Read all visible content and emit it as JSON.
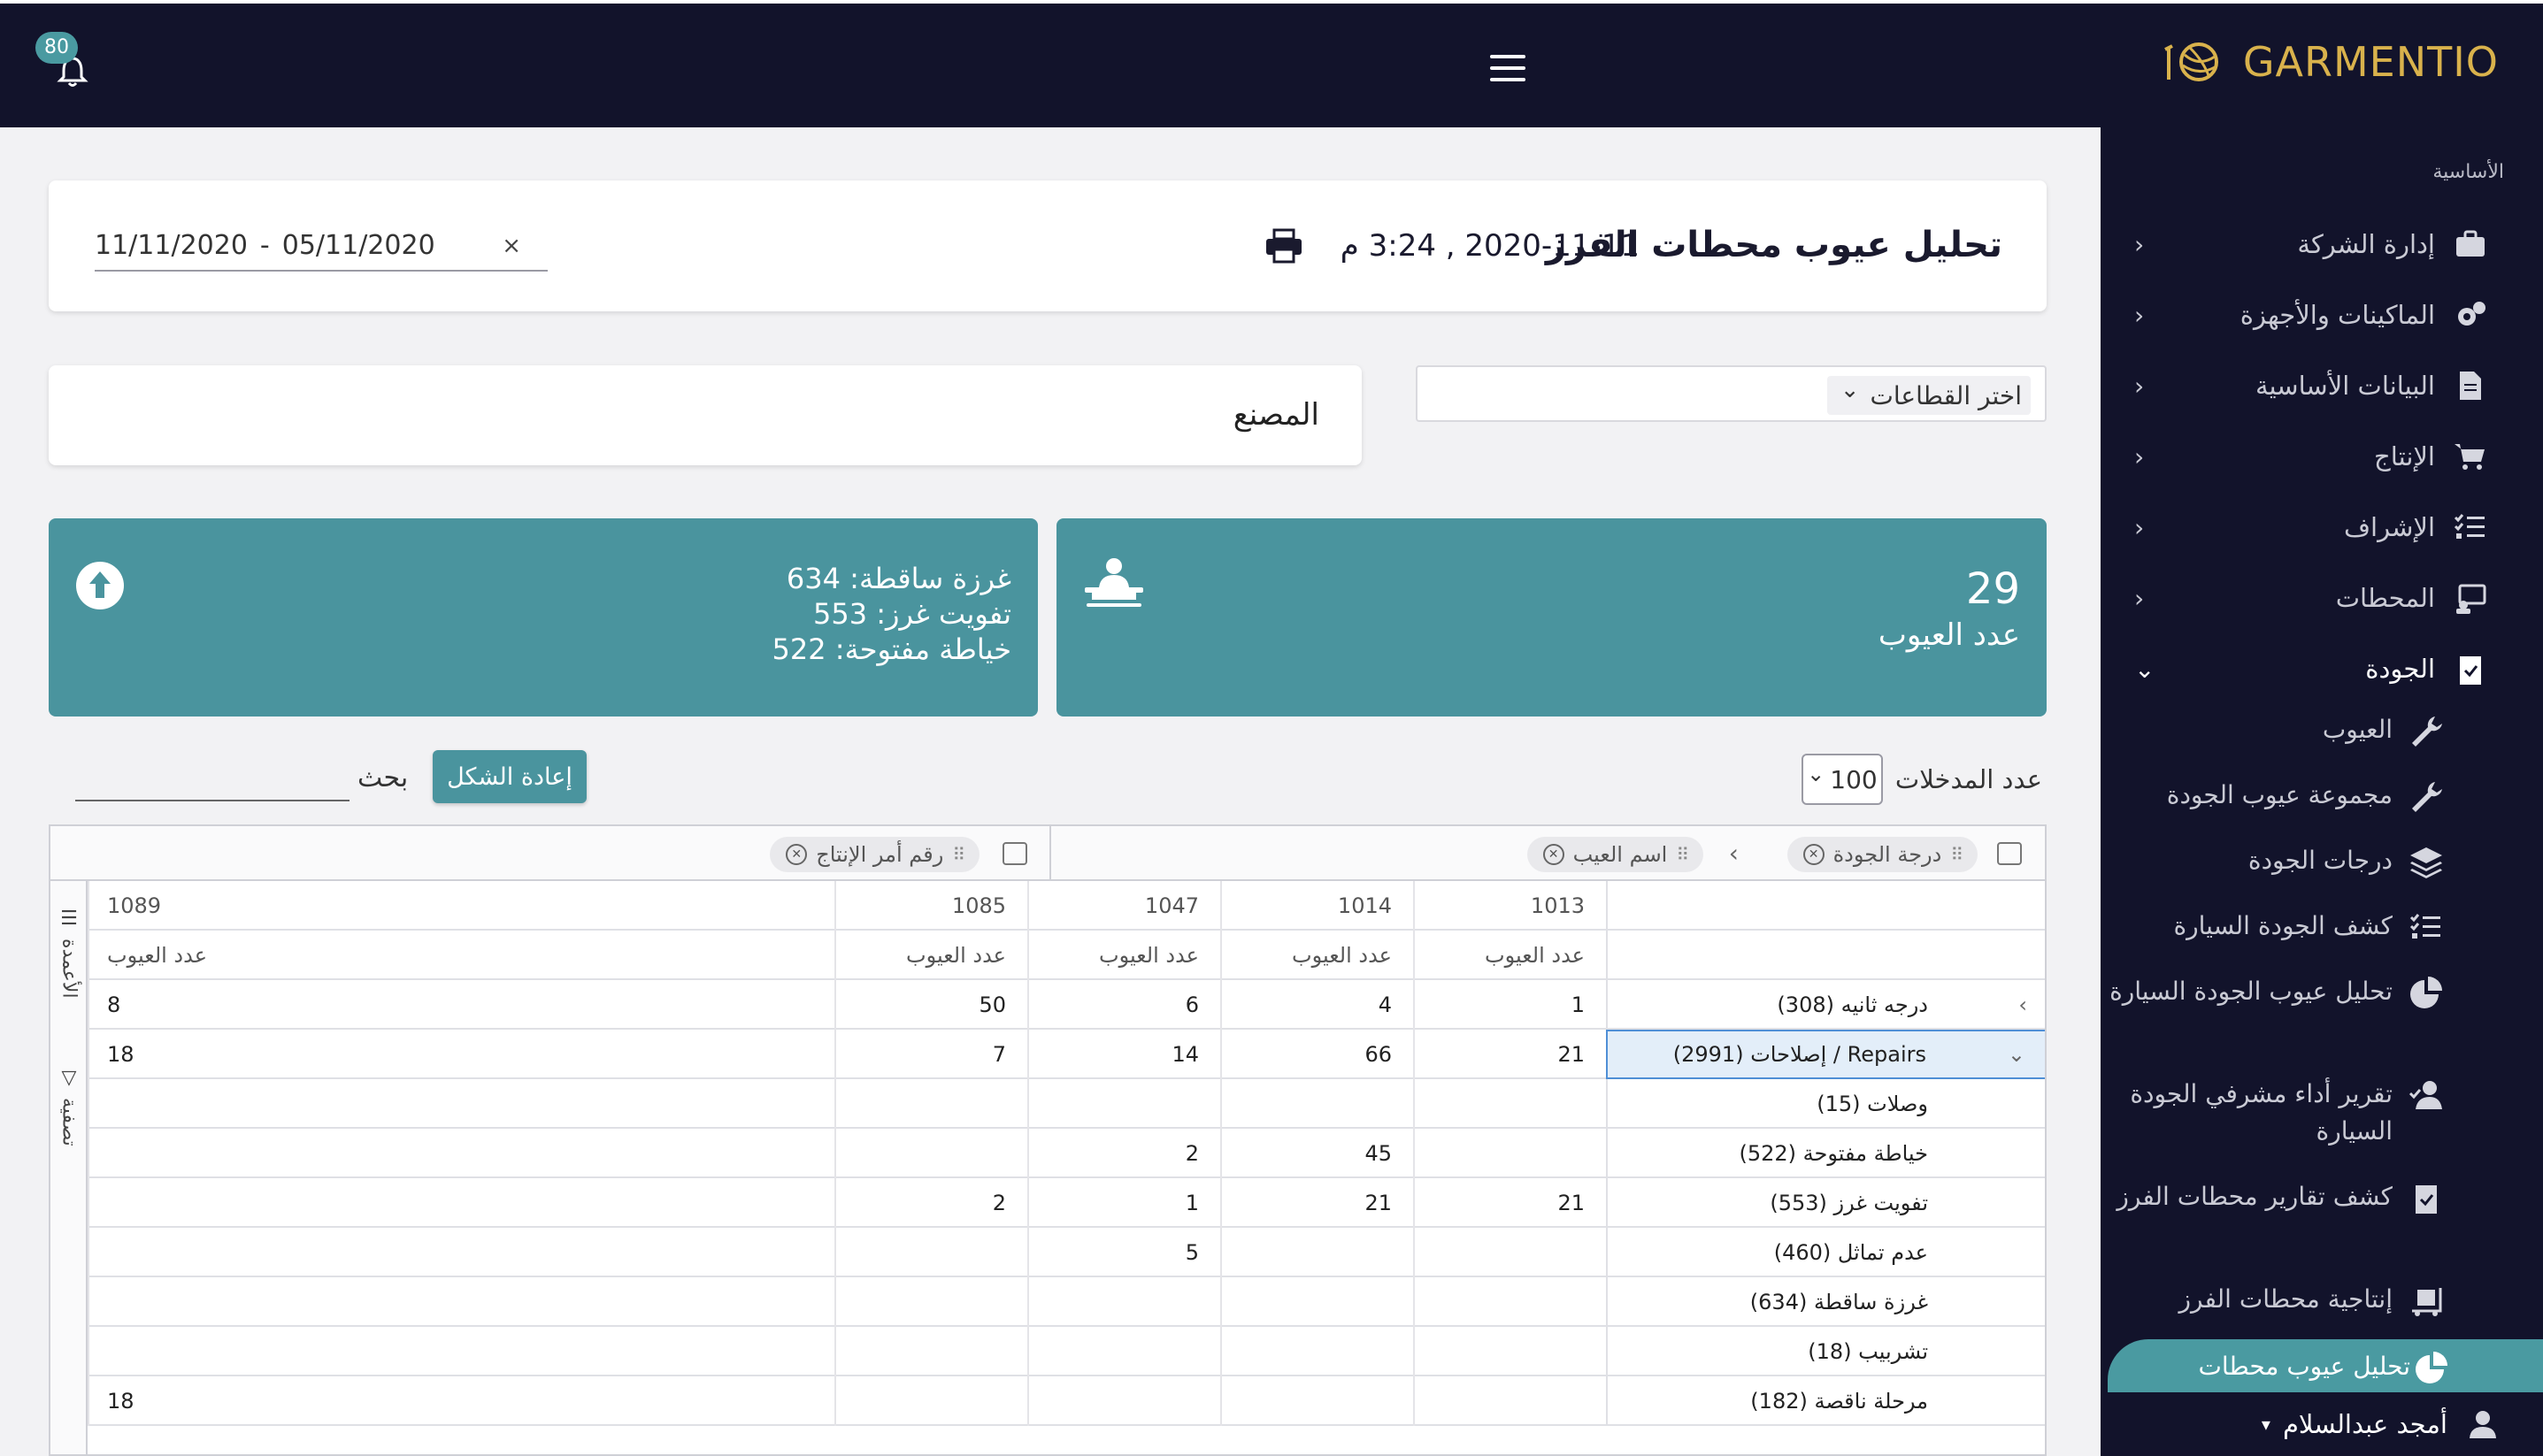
{
  "topbar": {
    "logo_text": "GARMENTIO",
    "notifications_count": "80"
  },
  "sidebar": {
    "section_label": "الأساسية",
    "items": [
      {
        "label": "إدارة الشركة",
        "icon": "briefcase-icon",
        "chevron": "‹"
      },
      {
        "label": "الماكينات والأجهزة",
        "icon": "gears-icon",
        "chevron": "‹"
      },
      {
        "label": "البيانات الأساسية",
        "icon": "file-icon",
        "chevron": "‹"
      },
      {
        "label": "الإنتاج",
        "icon": "cart-icon",
        "chevron": "‹"
      },
      {
        "label": "الإشراف",
        "icon": "tasks-icon",
        "chevron": "‹"
      },
      {
        "label": "المحطات",
        "icon": "station-icon",
        "chevron": "‹"
      },
      {
        "label": "الجودة",
        "icon": "clipboard-check-icon",
        "chevron": "⌄"
      }
    ],
    "subitems": [
      {
        "label": "العيوب",
        "icon": "wrench-icon"
      },
      {
        "label": "مجموعة عيوب الجودة",
        "icon": "wrench-icon"
      },
      {
        "label": "درجات الجودة",
        "icon": "layers-icon"
      },
      {
        "label": "كشف الجودة السيارة",
        "icon": "tasks-icon"
      },
      {
        "label": "تحليل عيوب الجودة السيارة",
        "icon": "pie-chart-icon"
      },
      {
        "label": "تقرير أداء مشرفي الجودة السيارة",
        "icon": "user-check-icon"
      },
      {
        "label": "كشف تقارير محطات الفرز",
        "icon": "clipboard-check-icon"
      },
      {
        "label": "إنتاجية محطات الفرز",
        "icon": "dolly-icon"
      }
    ],
    "current": "تحليل عيوب محطات",
    "user": "أمجد عبدالسلام",
    "user_caret": "▾"
  },
  "header": {
    "title": "تحليل عيوب محطات الفرز",
    "datetime": "2020-11-11 , 3:24 م",
    "date_from": "05/11/2020",
    "date_sep": "-",
    "date_to": "11/11/2020",
    "clear": "×"
  },
  "filters": {
    "factory": "المصنع",
    "sectors": "اختر القطاعات",
    "sectors_chevron": "⌄"
  },
  "stats": {
    "defects_count": "29",
    "defects_label": "عدد العيوب",
    "top_defects": [
      "غرزة ساقطة:  634",
      "تفويت غرز:  553",
      "خياطة مفتوحة:  522"
    ]
  },
  "table_controls": {
    "entries_label": "عدد المدخلات",
    "entries_value": "100",
    "entries_chevron": "⌄",
    "reset_label": "إعادة الشكل",
    "search_label": "بحث"
  },
  "pivot": {
    "row_chips": [
      "درجة الجودة",
      "اسم العيب"
    ],
    "chip_separator": "‹",
    "col_chips": [
      "رقم أمر الإنتاج"
    ],
    "chip_grip": "⠿",
    "chip_close": "✕",
    "side_tabs": [
      "الأعمدة",
      "تصفية"
    ],
    "side_tab_icons": [
      "☰",
      "▽"
    ],
    "column_ids": [
      "1013",
      "1014",
      "1047",
      "1085",
      "1089"
    ],
    "measure_label": "عدد العيوب",
    "rows": [
      {
        "label": "درجه ثانيه (308)",
        "chevron": "›",
        "values": [
          "1",
          "4",
          "6",
          "50",
          "8"
        ]
      },
      {
        "label": "Repairs / إصلاحات (2991)",
        "chevron": "⌄",
        "values": [
          "21",
          "66",
          "14",
          "7",
          "18"
        ]
      },
      {
        "label": "وصلات (15)",
        "values": [
          "",
          "",
          "",
          "",
          ""
        ]
      },
      {
        "label": "خياطة مفتوحة (522)",
        "values": [
          "",
          "45",
          "2",
          "",
          ""
        ]
      },
      {
        "label": "تفويت غرز (553)",
        "values": [
          "21",
          "21",
          "1",
          "2",
          ""
        ]
      },
      {
        "label": "عدم تماثل (460)",
        "values": [
          "",
          "",
          "5",
          "",
          ""
        ]
      },
      {
        "label": "غرزة ساقطة (634)",
        "values": [
          "",
          "",
          "",
          "",
          ""
        ]
      },
      {
        "label": "تشربيب (18)",
        "values": [
          "",
          "",
          "",
          "",
          ""
        ]
      },
      {
        "label": "مرحلة ناقصة (182)",
        "values": [
          "",
          "",
          "",
          "",
          "18"
        ]
      }
    ]
  }
}
